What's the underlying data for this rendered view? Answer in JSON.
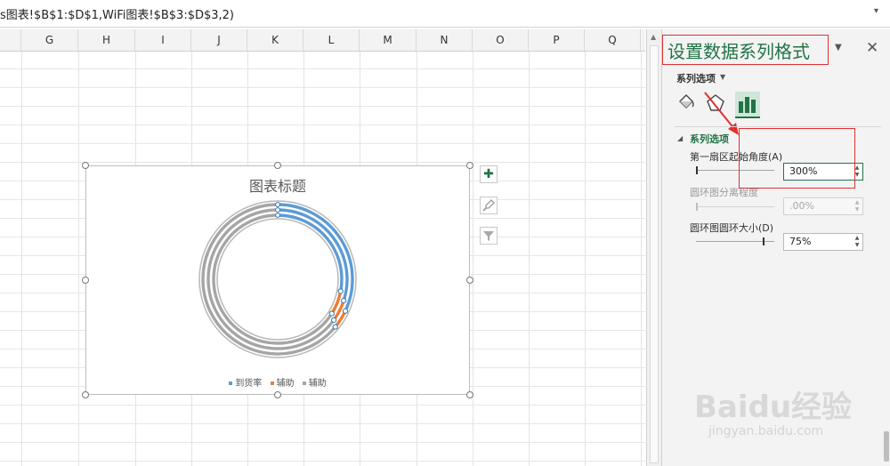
{
  "formula_bar": {
    "formula": "s图表!$B$1:$D$1,WiFi图表!$B$3:$D$3,2)"
  },
  "columns": [
    "G",
    "H",
    "I",
    "J",
    "K",
    "L",
    "M",
    "N",
    "O",
    "P",
    "Q"
  ],
  "chart": {
    "title": "图表标题",
    "legend": [
      {
        "label": "到货率",
        "color": "#5b9bd5"
      },
      {
        "label": "辅助",
        "color": "#ed7d31"
      },
      {
        "label": "辅助",
        "color": "#a5a5a5"
      }
    ],
    "tool_buttons": {
      "add": "✚",
      "style": "brush-icon",
      "filter": "filter-icon"
    }
  },
  "chart_data": {
    "type": "doughnut",
    "title": "图表标题",
    "first_slice_angle_deg": 300,
    "hole_size_percent": 75,
    "rings": [
      {
        "name": "到货率",
        "blue": 0.32,
        "orange": 0.04,
        "gray": 0.64
      },
      {
        "name": "辅助",
        "blue": 0.3,
        "orange": 0.05,
        "gray": 0.65
      },
      {
        "name": "辅助",
        "blue": 0.28,
        "orange": 0.06,
        "gray": 0.66
      }
    ],
    "colors": {
      "blue": "#5b9bd5",
      "orange": "#ed7d31",
      "gray": "#a5a5a5"
    }
  },
  "pane": {
    "title": "设置数据系列格式",
    "subtitle": "系列选项",
    "section": "系列选项",
    "first_angle_label": "第一扇区起始角度(A)",
    "first_angle_value": "300%",
    "explosion_label": "圆环图分离程度",
    "explosion_value": ".00%",
    "hole_label": "圆环图圆环大小(D)",
    "hole_value": "75%"
  },
  "watermark": {
    "logo": "Baidu经验",
    "url": "jingyan.baidu.com"
  }
}
